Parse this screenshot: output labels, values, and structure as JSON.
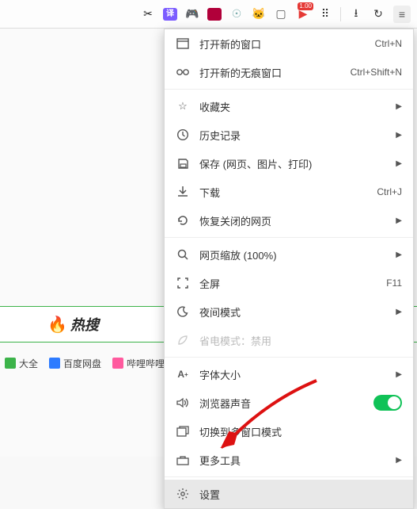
{
  "toolbar": {
    "translate_label": "译",
    "flag_badge": "1.00"
  },
  "page": {
    "hot_search": "热搜",
    "links": [
      {
        "label": "大全",
        "icon_color": "#3cb34a"
      },
      {
        "label": "百度网盘",
        "icon_color": "#2d7bff"
      },
      {
        "label": "哔哩哔哩",
        "icon_color": "#ff5a9e"
      }
    ]
  },
  "menu": {
    "new_window": {
      "label": "打开新的窗口",
      "hint": "Ctrl+N"
    },
    "new_incognito": {
      "label": "打开新的无痕窗口",
      "hint": "Ctrl+Shift+N"
    },
    "favorites": {
      "label": "收藏夹"
    },
    "history": {
      "label": "历史记录"
    },
    "save": {
      "label": "保存 (网页、图片、打印)"
    },
    "downloads": {
      "label": "下载",
      "hint": "Ctrl+J"
    },
    "reopen": {
      "label": "恢复关闭的网页"
    },
    "zoom": {
      "label": "网页缩放 (100%)"
    },
    "fullscreen": {
      "label": "全屏",
      "hint": "F11"
    },
    "night": {
      "label": "夜间模式"
    },
    "powersave": {
      "label": "省电模式：禁用"
    },
    "fontsize": {
      "label": "字体大小"
    },
    "sound": {
      "label": "浏览器声音"
    },
    "multiwindow": {
      "label": "切换到多窗口模式"
    },
    "moretools": {
      "label": "更多工具"
    },
    "settings": {
      "label": "设置"
    }
  }
}
